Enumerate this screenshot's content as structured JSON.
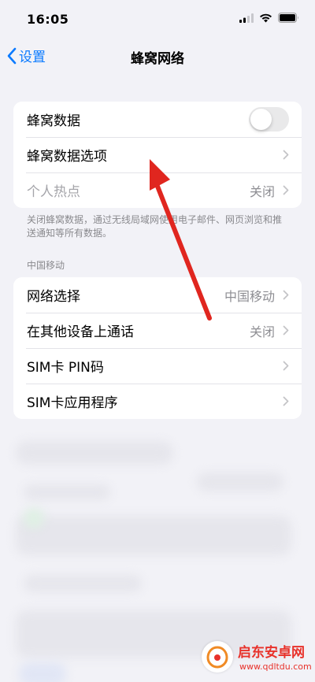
{
  "status_bar": {
    "time": "16:05",
    "icons": [
      "signal-icon",
      "wifi-icon",
      "battery-icon"
    ]
  },
  "nav": {
    "back_label": "设置",
    "title": "蜂窝网络"
  },
  "section1": {
    "rows": [
      {
        "label": "蜂窝数据",
        "toggle_on": false
      },
      {
        "label": "蜂窝数据选项",
        "value": ""
      },
      {
        "label": "个人热点",
        "value": "关闭",
        "disabled": true
      }
    ],
    "footnote": "关闭蜂窝数据，通过无线局域网使用电子邮件、网页浏览和推送通知等所有数据。"
  },
  "section2": {
    "header": "中国移动",
    "rows": [
      {
        "label": "网络选择",
        "value": "中国移动"
      },
      {
        "label": "在其他设备上通话",
        "value": "关闭"
      },
      {
        "label": "SIM卡 PIN码",
        "value": ""
      },
      {
        "label": "SIM卡应用程序",
        "value": ""
      }
    ]
  },
  "watermark": {
    "title": "启东安卓网",
    "url": "www.qdltdu.com"
  },
  "colors": {
    "background": "#f2f2f7",
    "accent": "#0a7aff",
    "arrow": "#e0261f",
    "secondary_text": "#8e8e93"
  }
}
